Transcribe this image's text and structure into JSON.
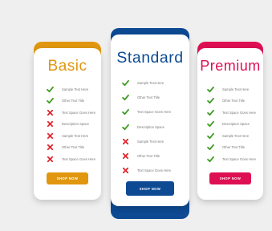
{
  "colors": {
    "basic": "#e0970f",
    "standard": "#0d4a93",
    "premium": "#de0f53",
    "check": "#3d9a22",
    "cross": "#e0262e",
    "background": "#efefef"
  },
  "plans": {
    "basic": {
      "title": "Basic",
      "button": "SHOP NOW",
      "features": [
        {
          "text": "Sample Text Here",
          "included": true,
          "icon": "check-icon"
        },
        {
          "text": "Other Text Title",
          "included": true,
          "icon": "check-icon"
        },
        {
          "text": "Text Space Goes Here",
          "included": false,
          "icon": "cross-icon"
        },
        {
          "text": "Description Space",
          "included": false,
          "icon": "cross-icon"
        },
        {
          "text": "Sample Text Here",
          "included": false,
          "icon": "cross-icon"
        },
        {
          "text": "Other Text Title",
          "included": false,
          "icon": "cross-icon"
        },
        {
          "text": "Text Space Goes Here",
          "included": false,
          "icon": "cross-icon"
        }
      ]
    },
    "standard": {
      "title": "Standard",
      "button": "SHOP NOW",
      "features": [
        {
          "text": "Sample Text Here",
          "included": true,
          "icon": "check-icon"
        },
        {
          "text": "Other Text Title",
          "included": true,
          "icon": "check-icon"
        },
        {
          "text": "Text Space Goes Here",
          "included": true,
          "icon": "check-icon"
        },
        {
          "text": "Description Space",
          "included": true,
          "icon": "check-icon"
        },
        {
          "text": "Sample Text Here",
          "included": false,
          "icon": "cross-icon"
        },
        {
          "text": "Other Text Title",
          "included": false,
          "icon": "cross-icon"
        },
        {
          "text": "Text Space Goes Here",
          "included": false,
          "icon": "cross-icon"
        }
      ]
    },
    "premium": {
      "title": "Premium",
      "button": "SHOP NOW",
      "features": [
        {
          "text": "Sample Text Here",
          "included": true,
          "icon": "check-icon"
        },
        {
          "text": "Other Text Title",
          "included": true,
          "icon": "check-icon"
        },
        {
          "text": "Text Space Goes Here",
          "included": true,
          "icon": "check-icon"
        },
        {
          "text": "Description Space",
          "included": true,
          "icon": "check-icon"
        },
        {
          "text": "Sample Text Here",
          "included": true,
          "icon": "check-icon"
        },
        {
          "text": "Other Text Title",
          "included": true,
          "icon": "check-icon"
        },
        {
          "text": "Text Space Goes Here",
          "included": true,
          "icon": "check-icon"
        }
      ]
    }
  }
}
